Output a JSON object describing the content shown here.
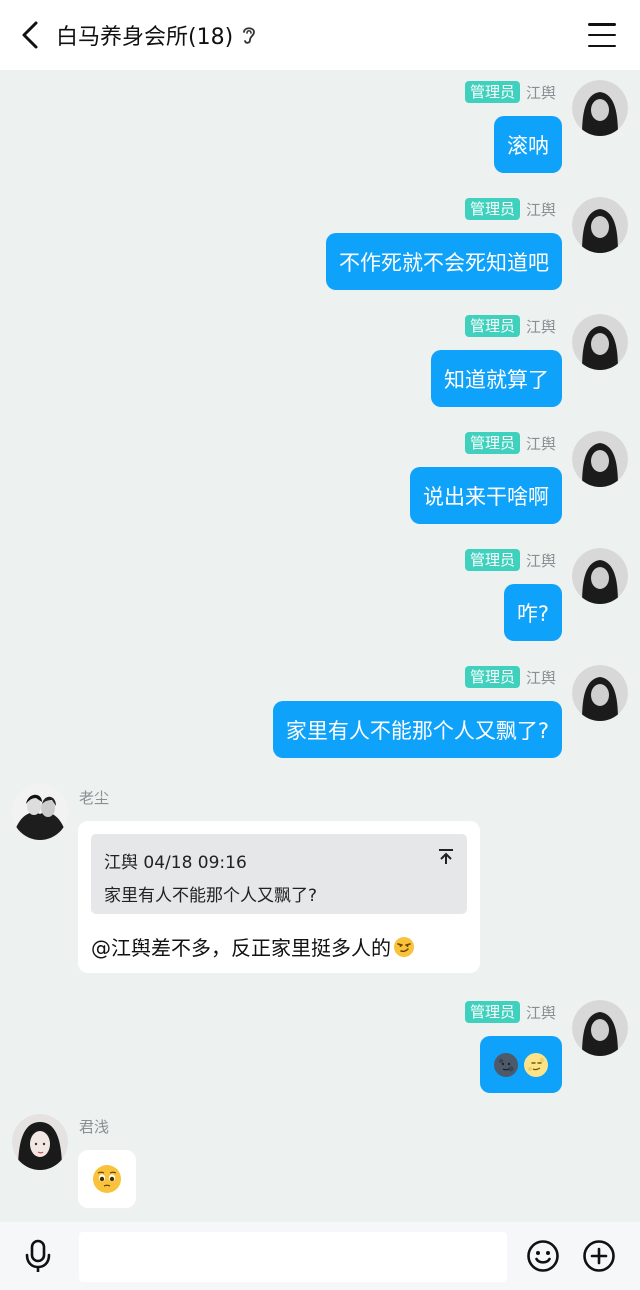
{
  "header": {
    "title": "白马养身会所(18)",
    "back_icon": "chevron-left-icon",
    "ear_icon": "ear-icon",
    "menu_icon": "hamburger-menu-icon"
  },
  "messages": [
    {
      "side": "right",
      "badge": "管理员",
      "sender": "江舆",
      "text": "滚呐"
    },
    {
      "side": "right",
      "badge": "管理员",
      "sender": "江舆",
      "text": "不作死就不会死知道吧"
    },
    {
      "side": "right",
      "badge": "管理员",
      "sender": "江舆",
      "text": "知道就算了"
    },
    {
      "side": "right",
      "badge": "管理员",
      "sender": "江舆",
      "text": "说出来干啥啊"
    },
    {
      "side": "right",
      "badge": "管理员",
      "sender": "江舆",
      "text": "咋?"
    },
    {
      "side": "right",
      "badge": "管理员",
      "sender": "江舆",
      "text": "家里有人不能那个人又飘了?"
    },
    {
      "side": "left",
      "sender": "老尘",
      "quote": {
        "header": "江舆 04/18 09:16",
        "text": "家里有人不能那个人又飘了?"
      },
      "mention": "@江舆",
      "text": " 差不多，反正家里挺多人的",
      "emoji": "smirk-emoji"
    },
    {
      "side": "right",
      "badge": "管理员",
      "sender": "江舆",
      "emojis": [
        "new-moon-face-emoji",
        "full-moon-face-emoji"
      ]
    },
    {
      "side": "left",
      "sender": "君浅",
      "emojis": [
        "pleading-face-emoji"
      ]
    }
  ],
  "composer": {
    "placeholder": "",
    "mic_icon": "microphone-icon",
    "emoji_icon": "smiley-icon",
    "plus_icon": "plus-circle-icon"
  },
  "colors": {
    "bubble_self": "#0fa2fb",
    "badge_admin": "#3fd1bd",
    "chat_background": "#edf1ef"
  }
}
